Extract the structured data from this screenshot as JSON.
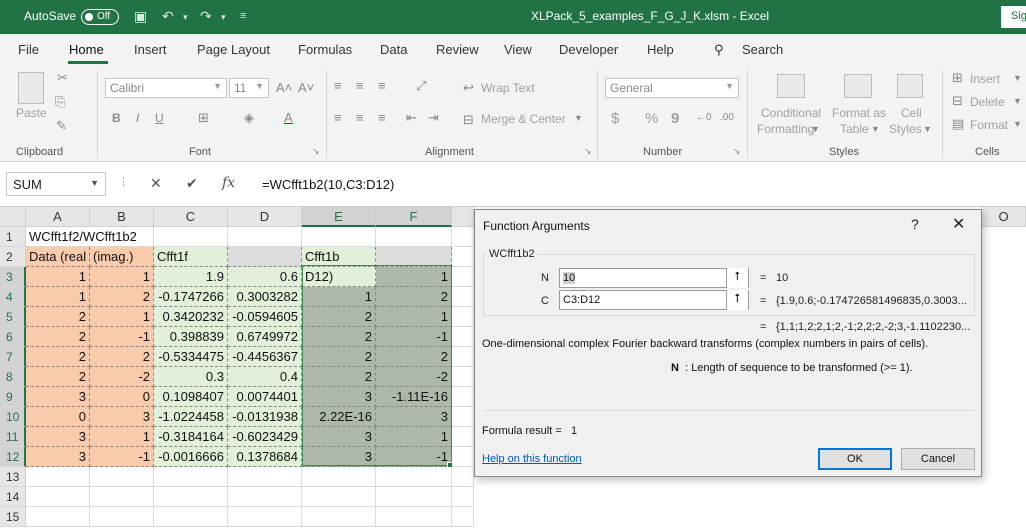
{
  "titlebar": {
    "autosave_label": "AutoSave",
    "autosave_state": "Off",
    "document_title": "XLPack_5_examples_F_G_J_K.xlsm  -  Excel",
    "sign_in": "Sig"
  },
  "tabs": [
    "File",
    "Home",
    "Insert",
    "Page Layout",
    "Formulas",
    "Data",
    "Review",
    "View",
    "Developer",
    "Help"
  ],
  "active_tab": "Home",
  "search_label": "Search",
  "ribbon": {
    "clipboard": {
      "paste": "Paste",
      "label": "Clipboard"
    },
    "font": {
      "font_name": "Calibri",
      "font_size": "11",
      "bold": "B",
      "italic": "I",
      "underline": "U",
      "label": "Font"
    },
    "alignment": {
      "wrap_text": "Wrap Text",
      "merge_center": "Merge & Center",
      "label": "Alignment"
    },
    "number": {
      "format": "General",
      "currency": "$",
      "percent": "%",
      "comma": "9",
      "label": "Number"
    },
    "styles": {
      "conditional_1": "Conditional",
      "conditional_2": "Formatting",
      "format_as_1": "Format as",
      "format_as_2": "Table",
      "cell_styles_1": "Cell",
      "cell_styles_2": "Styles",
      "label": "Styles"
    },
    "cells": {
      "insert": "Insert",
      "delete": "Delete",
      "format": "Format",
      "label": "Cells"
    }
  },
  "formula_bar": {
    "name_box": "SUM",
    "fx": "fx",
    "formula": "=WCfft1b2(10,C3:D12)"
  },
  "grid": {
    "columns": [
      "A",
      "B",
      "C",
      "D",
      "E",
      "F",
      "O"
    ],
    "rows": [
      "1",
      "2",
      "3",
      "4",
      "5",
      "6",
      "7",
      "8",
      "9",
      "10",
      "11",
      "12",
      "13",
      "14",
      "15"
    ],
    "cells": {
      "A1": "WCfft1f2/WCfft1b2",
      "A2": "Data (real",
      "B2": "(imag.)",
      "C2": "Cfft1f",
      "E2": "Cfft1b",
      "A3": "1",
      "B3": "1",
      "C3": "1.9",
      "D3": "0.6",
      "E3": "D12)",
      "F3": "1",
      "A4": "1",
      "B4": "2",
      "C4": "-0.1747266",
      "D4": "0.3003282",
      "E4": "1",
      "F4": "2",
      "A5": "2",
      "B5": "1",
      "C5": "0.3420232",
      "D5": "-0.0594605",
      "E5": "2",
      "F5": "1",
      "A6": "2",
      "B6": "-1",
      "C6": "0.398839",
      "D6": "0.6749972",
      "E6": "2",
      "F6": "-1",
      "A7": "2",
      "B7": "2",
      "C7": "-0.5334475",
      "D7": "-0.4456367",
      "E7": "2",
      "F7": "2",
      "A8": "2",
      "B8": "-2",
      "C8": "0.3",
      "D8": "0.4",
      "E8": "2",
      "F8": "-2",
      "A9": "3",
      "B9": "0",
      "C9": "0.1098407",
      "D9": "0.0074401",
      "E9": "3",
      "F9": "-1.11E-16",
      "A10": "0",
      "B10": "3",
      "C10": "-1.0224458",
      "D10": "-0.0131938",
      "E10": "2.22E-16",
      "F10": "3",
      "A11": "3",
      "B11": "1",
      "C11": "-0.3184164",
      "D11": "-0.6023429",
      "E11": "3",
      "F11": "1",
      "A12": "3",
      "B12": "-1",
      "C12": "-0.0016666",
      "D12": "0.1378684",
      "E12": "3",
      "F12": "-1"
    }
  },
  "dialog": {
    "title": "Function Arguments",
    "help_glyph": "?",
    "close_glyph": "✕",
    "function_name": "WCfft1b2",
    "args": [
      {
        "label": "N",
        "value": "10",
        "result": "10"
      },
      {
        "label": "C",
        "value": "C3:D12",
        "result": "{1.9,0.6;-0.174726581496835,0.3003..."
      }
    ],
    "overall_result": "{1,1;1,2;2,1;2,-1;2,2;2,-2;3,-1.1102230...",
    "description": "One-dimensional complex Fourier backward transforms (complex numbers in pairs of cells).",
    "arg_desc_name": "N",
    "arg_desc_text": ": Length of sequence to be transformed (>= 1).",
    "formula_result_label": "Formula result =",
    "formula_result_value": "1",
    "help_link": "Help on this function",
    "ok": "OK",
    "cancel": "Cancel"
  }
}
